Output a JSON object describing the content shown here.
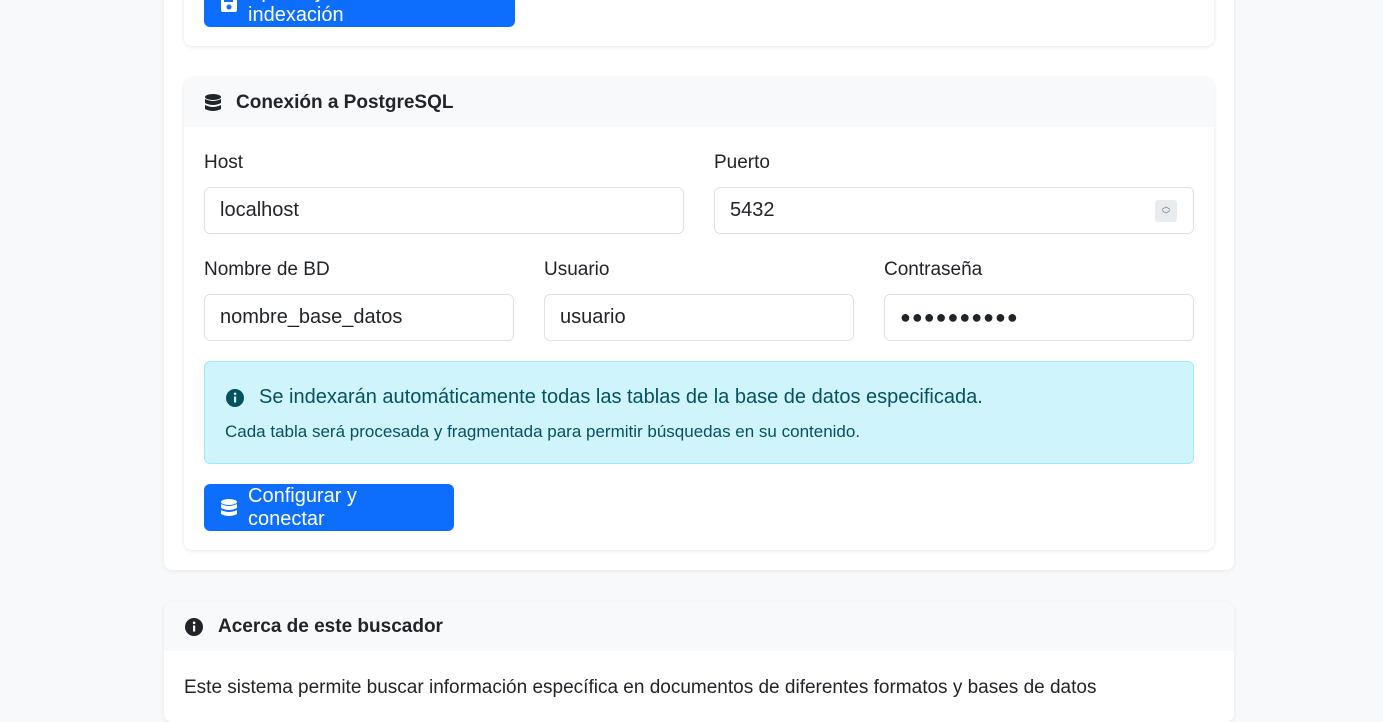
{
  "top_section": {
    "apply_button_label": "Aplicar y reiniciar indexación"
  },
  "postgres": {
    "header_title": "Conexión a PostgreSQL",
    "host_label": "Host",
    "host_value": "localhost",
    "port_label": "Puerto",
    "port_value": "5432",
    "dbname_label": "Nombre de BD",
    "dbname_value": "nombre_base_datos",
    "user_label": "Usuario",
    "user_value": "usuario",
    "password_label": "Contraseña",
    "password_mask": "●●●●●●●●●●",
    "info_title": "Se indexarán automáticamente todas las tablas de la base de datos especificada.",
    "info_detail": "Cada tabla será procesada y fragmentada para permitir búsquedas en su contenido.",
    "connect_button_label": "Configurar y conectar"
  },
  "about": {
    "header_title": "Acerca de este buscador",
    "description": "Este sistema permite buscar información específica en documentos de diferentes formatos y bases de datos"
  },
  "colors": {
    "primary": "#0d6efd",
    "info_bg": "#cff4fc",
    "info_text": "#055160"
  }
}
